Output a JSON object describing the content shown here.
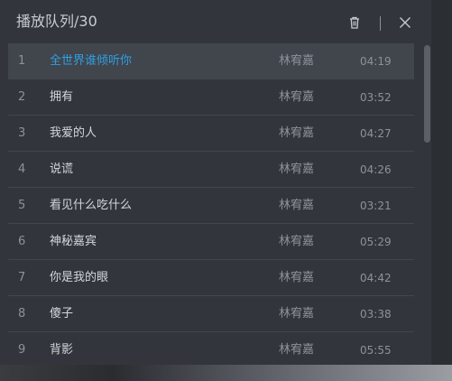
{
  "header": {
    "title": "播放队列",
    "separator": "/",
    "count": "30",
    "icons": {
      "clear": "trash-icon",
      "close": "close-icon"
    }
  },
  "queue": {
    "active_index": 0,
    "accent_color": "#2f9fe3",
    "items": [
      {
        "index": "1",
        "title": "全世界谁倾听你",
        "artist": "林宥嘉",
        "duration": "04:19"
      },
      {
        "index": "2",
        "title": "拥有",
        "artist": "林宥嘉",
        "duration": "03:52"
      },
      {
        "index": "3",
        "title": "我爱的人",
        "artist": "林宥嘉",
        "duration": "04:27"
      },
      {
        "index": "4",
        "title": "说谎",
        "artist": "林宥嘉",
        "duration": "04:26"
      },
      {
        "index": "5",
        "title": "看见什么吃什么",
        "artist": "林宥嘉",
        "duration": "03:21"
      },
      {
        "index": "6",
        "title": "神秘嘉宾",
        "artist": "林宥嘉",
        "duration": "05:29"
      },
      {
        "index": "7",
        "title": "你是我的眼",
        "artist": "林宥嘉",
        "duration": "04:42"
      },
      {
        "index": "8",
        "title": "傻子",
        "artist": "林宥嘉",
        "duration": "03:38"
      },
      {
        "index": "9",
        "title": "背影",
        "artist": "林宥嘉",
        "duration": "05:55"
      }
    ]
  }
}
